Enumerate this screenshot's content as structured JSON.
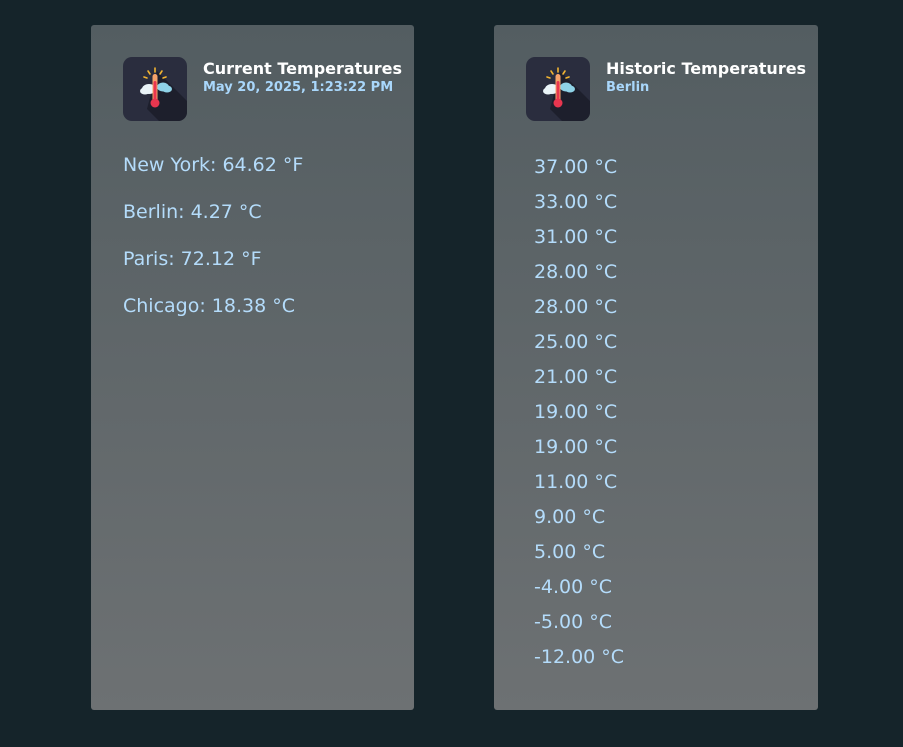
{
  "colors": {
    "page_background": "#15242a",
    "card_background_top": "#535d61",
    "card_background_bottom": "#6d7173",
    "title_text": "#ffffff",
    "accent_text": "#a9d7fb",
    "value_text": "#b4dcfb"
  },
  "current_card": {
    "icon": "thermometer-weather-icon",
    "title": "Current Temperatures",
    "subtitle": "May 20, 2025, 1:23:22 PM",
    "readings": [
      {
        "text": "New York: 64.62 °F"
      },
      {
        "text": "Berlin: 4.27 °C"
      },
      {
        "text": "Paris: 72.12 °F"
      },
      {
        "text": "Chicago: 18.38 °C"
      }
    ]
  },
  "historic_card": {
    "icon": "thermometer-weather-icon",
    "title": "Historic Temperatures",
    "subtitle": "Berlin",
    "values": [
      "37.00 °C",
      "33.00 °C",
      "31.00 °C",
      "28.00 °C",
      "28.00 °C",
      "25.00 °C",
      "21.00 °C",
      "19.00 °C",
      "19.00 °C",
      "11.00 °C",
      "9.00 °C",
      "5.00 °C",
      "-4.00 °C",
      "-5.00 °C",
      "-12.00 °C"
    ]
  }
}
